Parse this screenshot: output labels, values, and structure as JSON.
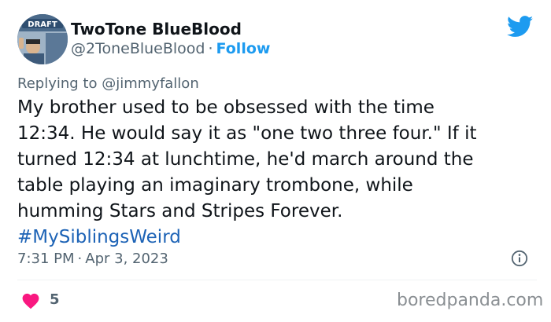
{
  "tweet": {
    "author": {
      "display_name": "TwoTone BlueBlood",
      "handle": "@2ToneBlueBlood",
      "separator": "·",
      "follow_label": "Follow",
      "avatar_badge_text": "DRAFT"
    },
    "brand_icon": "twitter-bird-icon",
    "replying_prefix": "Replying to",
    "replying_to": "@jimmyfallon",
    "text_lines": [
      "My brother used to be obsessed with the time",
      "12:34. He would say it as \"one two three four.\" If it",
      "turned 12:34 at lunchtime, he'd march around the",
      "table playing an imaginary trombone, while",
      "humming Stars and Stripes Forever."
    ],
    "hashtag": "#MySiblingsWeird",
    "time": "7:31 PM",
    "date_separator": "·",
    "date": "Apr 3, 2023",
    "info_icon": "info-icon",
    "likes": {
      "icon": "heart-icon",
      "count": "5"
    }
  },
  "watermark": "boredpanda.com",
  "colors": {
    "twitter_blue": "#1d9bf0",
    "hashtag_blue": "#1d63b6",
    "heart_pink": "#f91880",
    "muted_text": "#536471",
    "body_text": "#0f1419"
  }
}
